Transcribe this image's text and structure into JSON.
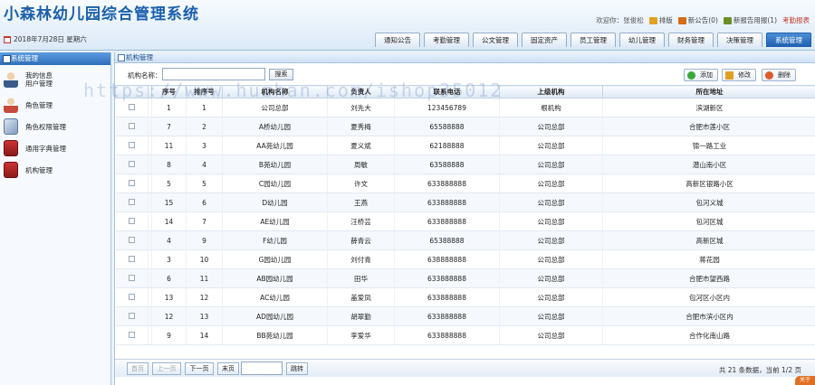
{
  "header": {
    "title": "小森林幼儿园综合管理系统",
    "welcome": "欢迎你：张俊松",
    "links": [
      {
        "label": "排版",
        "color": "#e0a020"
      },
      {
        "label": "新公告(0)",
        "color": "#d46a1a"
      },
      {
        "label": "新报告用报(1)",
        "color": "#6b8e23"
      },
      {
        "label": "考勤报表",
        "color": "#c0392b"
      }
    ],
    "date": "2018年7月28日 星期六"
  },
  "tabs": [
    {
      "label": "通知公告",
      "active": false
    },
    {
      "label": "考勤管理",
      "active": false
    },
    {
      "label": "公文管理",
      "active": false
    },
    {
      "label": "固定资产",
      "active": false
    },
    {
      "label": "员工管理",
      "active": false
    },
    {
      "label": "幼儿管理",
      "active": false
    },
    {
      "label": "财务管理",
      "active": false
    },
    {
      "label": "决策管理",
      "active": false
    },
    {
      "label": "系统管理",
      "active": true
    }
  ],
  "sidebar": {
    "title": "系统管理",
    "items": [
      {
        "label": "我的信息",
        "sub": "用户管理",
        "icon": "person-icon"
      },
      {
        "label": "角色管理",
        "sub": "",
        "icon": "role-icon"
      },
      {
        "label": "角色权限管理",
        "sub": "",
        "icon": "permission-icon"
      },
      {
        "label": "通用字典管理",
        "sub": "",
        "icon": "dictionary-icon"
      },
      {
        "label": "机构管理",
        "sub": "",
        "icon": "organization-icon"
      }
    ]
  },
  "main": {
    "panel_title": "机构管理",
    "search": {
      "label": "机构名称：",
      "value": "",
      "button": "搜索"
    },
    "toolbar": {
      "add": "添加",
      "edit": "修改",
      "delete": "删除"
    },
    "columns": [
      "",
      "",
      "序号",
      "排序号",
      "机构名称",
      "负责人",
      "联系电话",
      "上级机构",
      "所在地址"
    ],
    "rows": [
      [
        "1",
        "1",
        "公司总部",
        "刘先大",
        "123456789",
        "根机构",
        "滨湖新区"
      ],
      [
        "7",
        "2",
        "A桥幼儿园",
        "夏秀梅",
        "65588888",
        "公司总部",
        "合肥市莲小区"
      ],
      [
        "11",
        "3",
        "AA苑幼儿园",
        "夏义斌",
        "62188888",
        "公司总部",
        "锦一路工业"
      ],
      [
        "8",
        "4",
        "B苑幼儿园",
        "周敏",
        "63588888",
        "公司总部",
        "潜山南小区"
      ],
      [
        "5",
        "5",
        "C园幼儿园",
        "许文",
        "633888888",
        "公司总部",
        "高新区银路小区"
      ],
      [
        "15",
        "6",
        "D幼儿园",
        "王燕",
        "633888888",
        "公司总部",
        "包河义城"
      ],
      [
        "14",
        "7",
        "AE幼儿园",
        "汪桥芸",
        "633888888",
        "公司总部",
        "包河区城"
      ],
      [
        "4",
        "9",
        "F幼儿园",
        "薛青云",
        "65388888",
        "公司总部",
        "高新区城"
      ],
      [
        "3",
        "10",
        "G园幼儿园",
        "刘付青",
        "638888888",
        "公司总部",
        "蒋花园"
      ],
      [
        "6",
        "11",
        "AB园幼儿园",
        "田华",
        "633888888",
        "公司总部",
        "合肥市望西路"
      ],
      [
        "13",
        "12",
        "AC幼儿园",
        "盖爱凤",
        "633888888",
        "公司总部",
        "包河区小区内"
      ],
      [
        "12",
        "13",
        "AD园幼儿园",
        "胡翠勤",
        "633888888",
        "公司总部",
        "合肥市滨小区内"
      ],
      [
        "9",
        "14",
        "BB苑幼儿园",
        "李爱华",
        "633888888",
        "公司总部",
        "合作化南山路"
      ]
    ],
    "pager": {
      "first": "首页",
      "prev": "上一页",
      "next": "下一页",
      "last": "末页",
      "go": "跳转",
      "info": "共 21 条数据，当前 1/2 页"
    }
  },
  "watermark": "https://www.huzhan.com/ishop35012",
  "badge": "关于"
}
